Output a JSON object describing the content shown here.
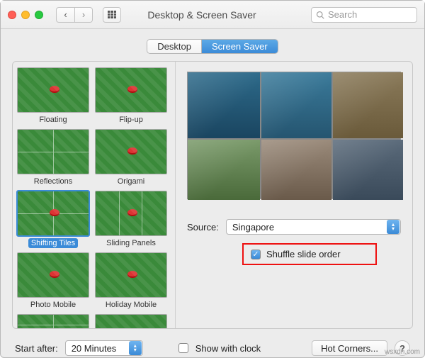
{
  "window": {
    "title": "Desktop & Screen Saver",
    "search_placeholder": "Search"
  },
  "tabs": {
    "desktop": "Desktop",
    "screensaver": "Screen Saver"
  },
  "savers": [
    {
      "label": "Floating",
      "selected": false
    },
    {
      "label": "Flip-up",
      "selected": false
    },
    {
      "label": "Reflections",
      "selected": false
    },
    {
      "label": "Origami",
      "selected": false
    },
    {
      "label": "Shifting Tiles",
      "selected": true
    },
    {
      "label": "Sliding Panels",
      "selected": false
    },
    {
      "label": "Photo Mobile",
      "selected": false
    },
    {
      "label": "Holiday Mobile",
      "selected": false
    }
  ],
  "source": {
    "label": "Source:",
    "value": "Singapore"
  },
  "shuffle": {
    "label": "Shuffle slide order",
    "checked": true
  },
  "bottom": {
    "start_after_label": "Start after:",
    "start_after_value": "20 Minutes",
    "show_with_clock_label": "Show with clock",
    "show_with_clock_checked": false,
    "hot_corners": "Hot Corners...",
    "help": "?"
  },
  "watermark": "wsxdn.com"
}
